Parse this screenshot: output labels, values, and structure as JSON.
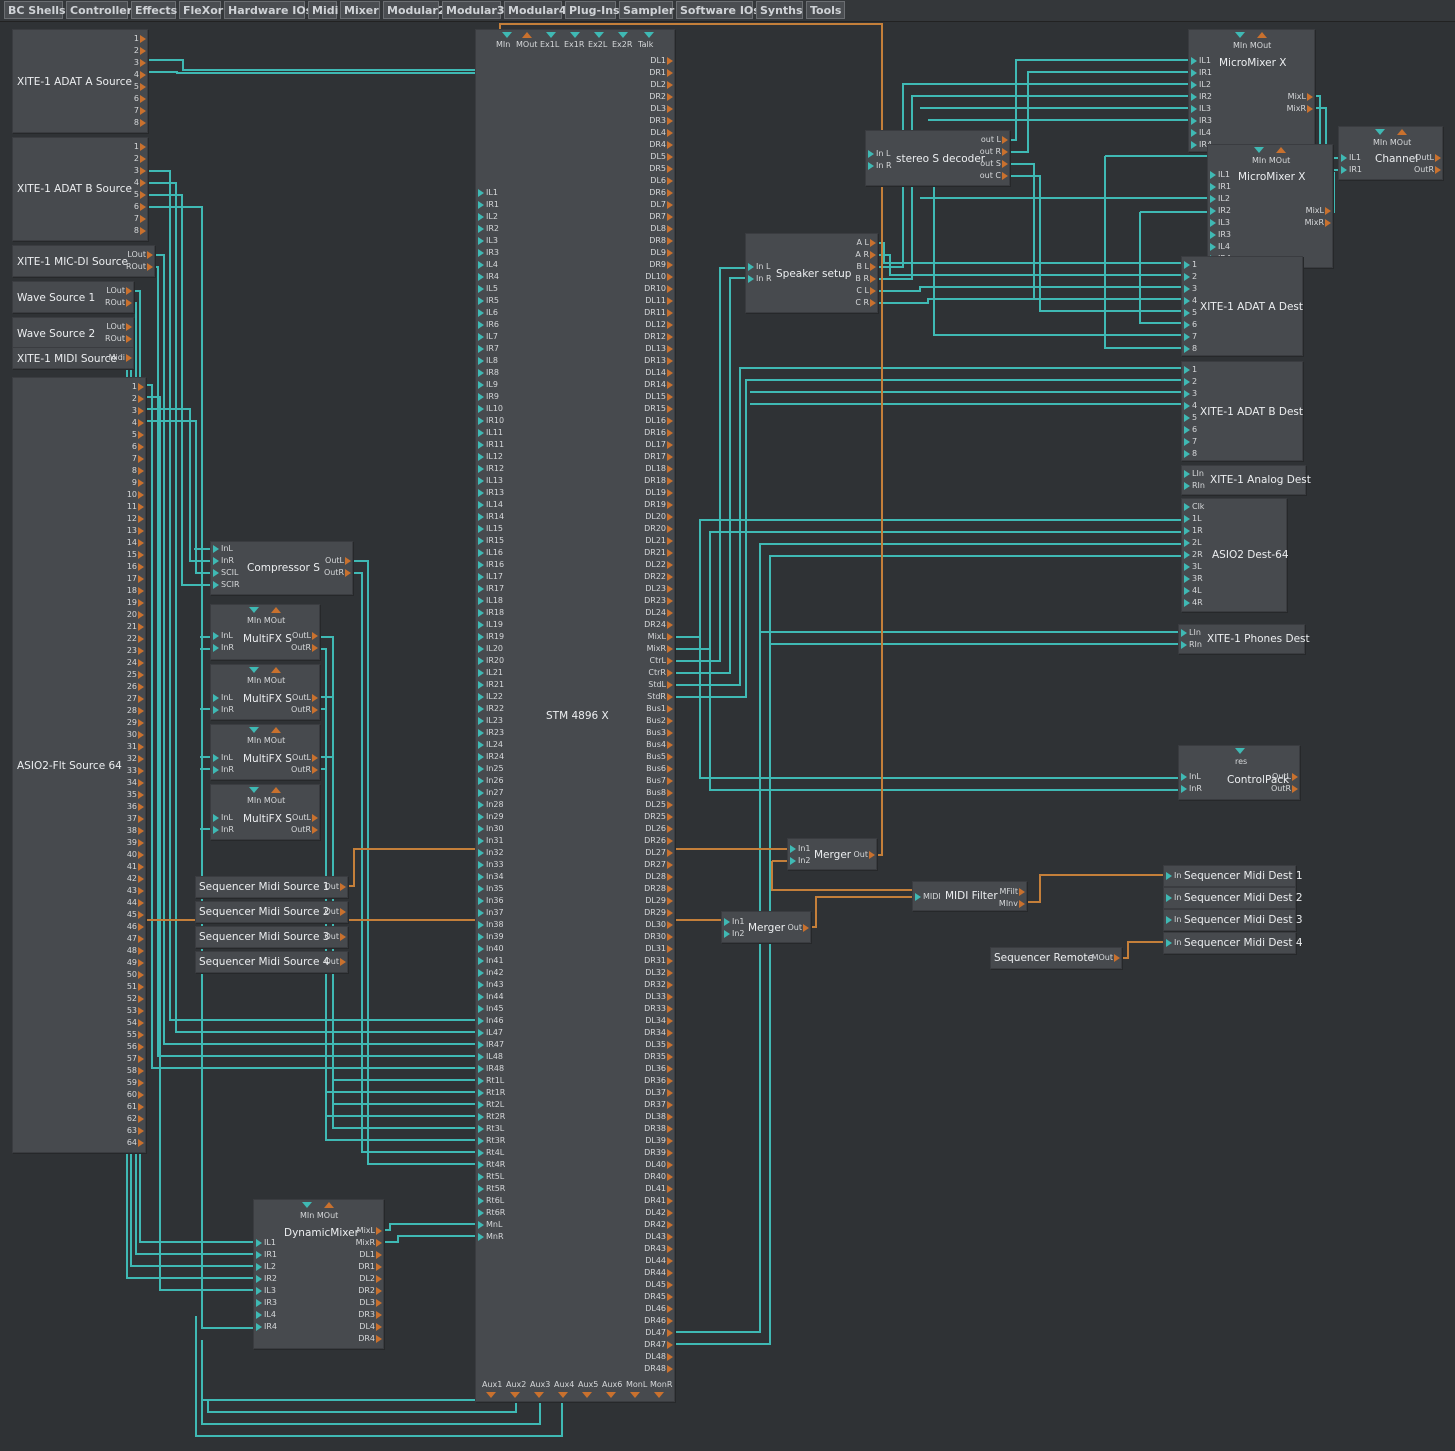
{
  "menu": [
    "BC Shells",
    "Controller",
    "Effects",
    "FleXor",
    "Hardware IOs",
    "Midi",
    "Mixer",
    "Modular2",
    "Modular3",
    "Modular4",
    "Plug-Ins",
    "Sampler",
    "Software IOs",
    "Synths",
    "Tools"
  ],
  "modules": {
    "adat_a_src": {
      "title": "XITE-1 ADAT A Source",
      "outs": [
        "1",
        "2",
        "3",
        "4",
        "5",
        "6",
        "7",
        "8"
      ]
    },
    "adat_b_src": {
      "title": "XITE-1 ADAT B Source",
      "outs": [
        "1",
        "2",
        "3",
        "4",
        "5",
        "6",
        "7",
        "8"
      ]
    },
    "micdi_src": {
      "title": "XITE-1 MIC-DI Source",
      "outs": [
        "LOut",
        "ROut"
      ]
    },
    "wave1": {
      "title": "Wave Source 1",
      "outs": [
        "LOut",
        "ROut"
      ]
    },
    "wave2": {
      "title": "Wave Source 2",
      "outs": [
        "LOut",
        "ROut"
      ]
    },
    "midi_src": {
      "title": "XITE-1 MIDI Source",
      "outs": [
        "Midi"
      ]
    },
    "asio_src": {
      "title": "ASIO2-Flt Source 64",
      "outs": [
        "1",
        "2",
        "3",
        "4",
        "5",
        "6",
        "7",
        "8",
        "9",
        "10",
        "11",
        "12",
        "13",
        "14",
        "15",
        "16",
        "17",
        "18",
        "19",
        "20",
        "21",
        "22",
        "23",
        "24",
        "25",
        "26",
        "27",
        "28",
        "29",
        "30",
        "31",
        "32",
        "33",
        "34",
        "35",
        "36",
        "37",
        "38",
        "39",
        "40",
        "41",
        "42",
        "43",
        "44",
        "45",
        "46",
        "47",
        "48",
        "49",
        "50",
        "51",
        "52",
        "53",
        "54",
        "55",
        "56",
        "57",
        "58",
        "59",
        "60",
        "61",
        "62",
        "63",
        "64"
      ]
    },
    "compressor": {
      "title": "Compressor S",
      "ins": [
        "InL",
        "InR",
        "SCIL",
        "SCIR"
      ],
      "outs": [
        "OutL",
        "OutR"
      ]
    },
    "mfx1": {
      "title": "MultiFX S",
      "top": "MIn MOut",
      "ins": [
        "InL",
        "InR"
      ],
      "outs": [
        "OutL",
        "OutR"
      ]
    },
    "mfx2": {
      "title": "MultiFX S",
      "top": "MIn MOut",
      "ins": [
        "InL",
        "InR"
      ],
      "outs": [
        "OutL",
        "OutR"
      ]
    },
    "mfx3": {
      "title": "MultiFX S",
      "top": "MIn MOut",
      "ins": [
        "InL",
        "InR"
      ],
      "outs": [
        "OutL",
        "OutR"
      ]
    },
    "mfx4": {
      "title": "MultiFX S",
      "top": "MIn MOut",
      "ins": [
        "InL",
        "InR"
      ],
      "outs": [
        "OutL",
        "OutR"
      ]
    },
    "seq1": {
      "title": "Sequencer Midi Source 1",
      "outs": [
        "Out"
      ]
    },
    "seq2": {
      "title": "Sequencer Midi Source 2",
      "outs": [
        "Out"
      ]
    },
    "seq3": {
      "title": "Sequencer Midi Source 3",
      "outs": [
        "Out"
      ]
    },
    "seq4": {
      "title": "Sequencer Midi Source 4",
      "outs": [
        "Out"
      ]
    },
    "dynmix": {
      "title": "DynamicMixer",
      "top": "MIn MOut",
      "ins": [
        "IL1",
        "IR1",
        "IL2",
        "IR2",
        "IL3",
        "IR3",
        "IL4",
        "IR4"
      ],
      "outs": [
        "MixL",
        "MixR",
        "DL1",
        "DR1",
        "DL2",
        "DR2",
        "DL3",
        "DR3",
        "DL4",
        "DR4"
      ]
    },
    "stm": {
      "title": "STM 4896 X",
      "top_labels": [
        "MIn",
        "MOut",
        "Ex1L",
        "Ex1R",
        "Ex2L",
        "Ex2R",
        "Talk"
      ],
      "bottom_labels": [
        "Aux1",
        "Aux2",
        "Aux3",
        "Aux4",
        "Aux5",
        "Aux6",
        "MonL",
        "MonR"
      ],
      "tail_outs": [
        "MixL",
        "MixR",
        "CtrL",
        "CtrR",
        "StdL",
        "StdR",
        "Bus1",
        "Bus2",
        "Bus3",
        "Bus4",
        "Bus5",
        "Bus6",
        "Bus7",
        "Bus8"
      ],
      "tail_ins": [
        "Rt1L",
        "Rt1R",
        "Rt2L",
        "Rt2R",
        "Rt3L",
        "Rt3R",
        "Rt4L",
        "Rt4R",
        "Rt5L",
        "Rt5R",
        "Rt6L",
        "Rt6R",
        "MnL",
        "MnR"
      ]
    },
    "speaker": {
      "title": "Speaker setup",
      "ins": [
        "In L",
        "In R"
      ],
      "outs": [
        "A L",
        "A R",
        "B L",
        "B R",
        "C L",
        "C R"
      ]
    },
    "stereo_dec": {
      "title": "stereo S decoder",
      "ins": [
        "In L",
        "In R"
      ],
      "outs": [
        "out L",
        "out R",
        "out S",
        "out C"
      ]
    },
    "micromix1": {
      "title": "MicroMixer X",
      "top": "MIn MOut",
      "ins": [
        "IL1",
        "IR1",
        "IL2",
        "IR2",
        "IL3",
        "IR3",
        "IL4",
        "IR4"
      ],
      "outs": [
        "MixL",
        "MixR"
      ]
    },
    "micromix2": {
      "title": "MicroMixer X",
      "top": "MIn MOut",
      "ins": [
        "IL1",
        "IR1",
        "IL2",
        "IR2",
        "IL3",
        "IR3",
        "IL4",
        "IR4"
      ],
      "outs": [
        "MixL",
        "MixR"
      ]
    },
    "channel": {
      "title": "Channel",
      "top": "MIn MOut",
      "ins": [
        "IL1",
        "IR1"
      ],
      "outs": [
        "OutL",
        "OutR"
      ]
    },
    "adat_a_dest": {
      "title": "XITE-1 ADAT A Dest",
      "ins": [
        "1",
        "2",
        "3",
        "4",
        "5",
        "6",
        "7",
        "8"
      ]
    },
    "adat_b_dest": {
      "title": "XITE-1 ADAT B Dest",
      "ins": [
        "1",
        "2",
        "3",
        "4",
        "5",
        "6",
        "7",
        "8"
      ]
    },
    "analog_dest": {
      "title": "XITE-1 Analog Dest",
      "ins": [
        "LIn",
        "RIn"
      ]
    },
    "asio_dest": {
      "title": "ASIO2 Dest-64",
      "ins": [
        "Clk",
        "1L",
        "1R",
        "2L",
        "2R",
        "3L",
        "3R",
        "4L",
        "4R"
      ]
    },
    "phones_dest": {
      "title": "XITE-1 Phones Dest",
      "ins": [
        "LIn",
        "RIn"
      ]
    },
    "controlpack": {
      "title": "ControlPack",
      "top": "res",
      "ins": [
        "InL",
        "InR"
      ],
      "outs": [
        "OutL",
        "OutR"
      ]
    },
    "merger1": {
      "title": "Merger",
      "ins": [
        "In1",
        "In2"
      ],
      "outs": [
        "Out"
      ]
    },
    "merger2": {
      "title": "Merger",
      "ins": [
        "In1",
        "In2"
      ],
      "outs": [
        "Out"
      ]
    },
    "midifilter": {
      "title": "MIDI Filter",
      "ins": [
        "MIDI"
      ],
      "outs": [
        "MFilt",
        "MInv"
      ]
    },
    "seqdest1": {
      "title": "Sequencer Midi Dest 1",
      "ins": [
        "In"
      ]
    },
    "seqdest2": {
      "title": "Sequencer Midi Dest 2",
      "ins": [
        "In"
      ]
    },
    "seqdest3": {
      "title": "Sequencer Midi Dest 3",
      "ins": [
        "In"
      ]
    },
    "seqdest4": {
      "title": "Sequencer Midi Dest 4",
      "ins": [
        "In"
      ]
    },
    "seqremote": {
      "title": "Sequencer Remote",
      "outs": [
        "MOut"
      ]
    }
  },
  "colors": {
    "canvas": "#2f3235",
    "module": "#474a4e",
    "audio_wire": "#3fb9b4",
    "midi_wire": "#c47f3a",
    "in_port": "#3fb9b4",
    "out_port": "#c9712e"
  }
}
